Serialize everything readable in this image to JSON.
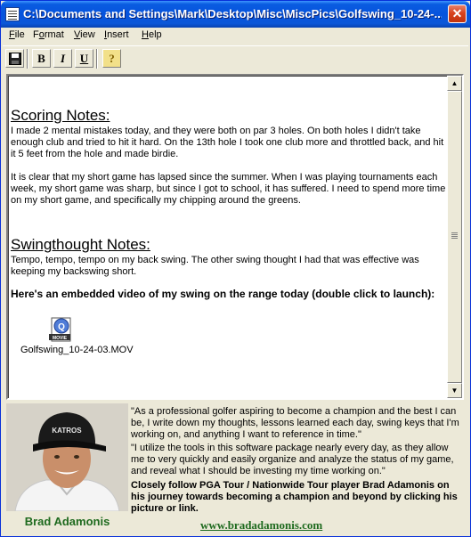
{
  "window": {
    "title": "C:\\Documents and Settings\\Mark\\Desktop\\Misc\\MiscPics\\Golfswing_10-24-...",
    "close_label": "✕"
  },
  "menu": [
    {
      "label": "File",
      "accel": "F",
      "rest": "ile"
    },
    {
      "label": "Format",
      "accel": "o",
      "pre": "F",
      "rest": "rmat"
    },
    {
      "label": "View",
      "accel": "V",
      "rest": "iew"
    },
    {
      "label": "Insert",
      "accel": "I",
      "rest": "nsert"
    },
    {
      "label": "Help",
      "accel": "H",
      "rest": "elp"
    }
  ],
  "toolbar": {
    "save_icon": "floppy-disk-icon",
    "bold": "B",
    "italic": "I",
    "underline": "U",
    "help": "?"
  },
  "document": {
    "scoring_heading": "Scoring Notes:",
    "scoring_p1": "I made 2 mental mistakes today, and they were both on par 3 holes.  On both holes I didn't take enough club and tried to hit it hard.  On the 13th hole I took one club more and throttled back, and hit it 5 feet from the hole and made birdie.",
    "scoring_p2": "It is clear that my short game has lapsed since the summer.  When I was playing tournaments each week, my short game was sharp, but since I got to school, it has suffered.  I need to spend more time on my short game, and specifically my chipping around the greens.",
    "swing_heading": "Swingthought Notes:",
    "swing_p1": "Tempo, tempo, tempo on my back swing.  The other swing thought I had that was effective was keeping my backswing short.",
    "video_intro": "Here's an embedded video of my swing on the range today (double click to launch):",
    "video_badge": "MOVIE",
    "video_file": "Golfswing_10-24-03.MOV"
  },
  "footer": {
    "player_name": "Brad Adamonis",
    "hat_text": "KATROS",
    "quote1": "\"As a professional golfer aspiring to become a champion and the best I can be, I write down my thoughts, lessons learned each day, swing keys that I'm working on, and anything I want to reference in time.\"",
    "quote2": "\"I utilize the tools in this software package nearly every day, as they allow me to very quickly and easily organize and analyze the status of my game, and reveal what I should be investing my time working on.\"",
    "promo": "Closely follow PGA Tour / Nationwide Tour player Brad Adamonis on his journey towards becoming a champion and beyond by clicking his picture or link.",
    "link": "www.bradadamonis.com"
  },
  "colors": {
    "titlebar": "#0654de",
    "close": "#d8441f",
    "brand_green": "#1e6a1e"
  }
}
